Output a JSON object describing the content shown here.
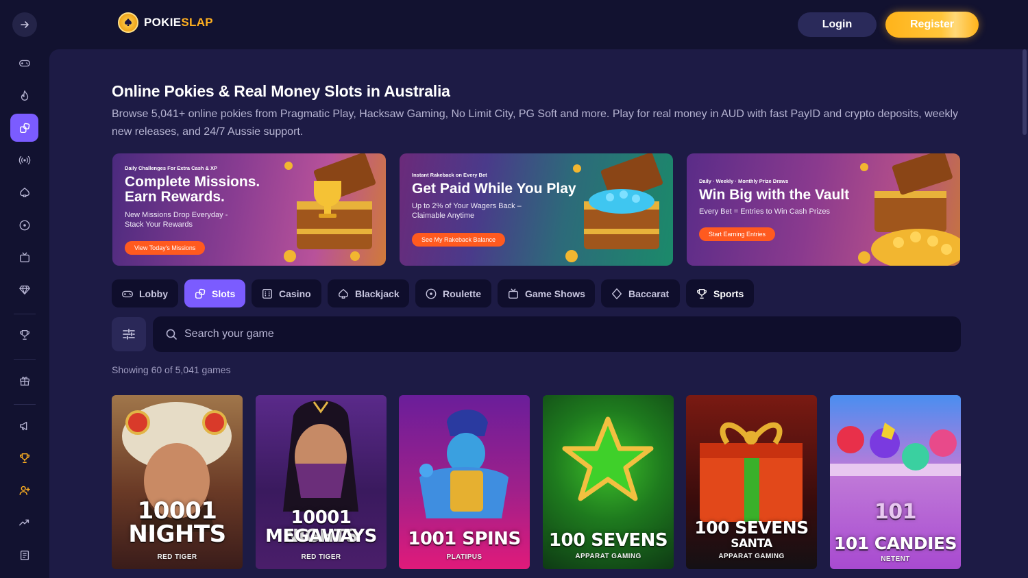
{
  "brand": {
    "name_main": "POKIE",
    "name_accent": "SLAP",
    "accent_color": "#ffb020",
    "primary_color": "#7b5cff"
  },
  "header": {
    "login_label": "Login",
    "register_label": "Register"
  },
  "sidebar": {
    "items": [
      {
        "name": "gamepad-icon",
        "active": false
      },
      {
        "name": "flame-icon",
        "active": false
      },
      {
        "name": "slots-icon",
        "active": true
      },
      {
        "name": "live-icon",
        "active": false
      },
      {
        "name": "blackjack-icon",
        "active": false
      },
      {
        "name": "roulette-icon",
        "active": false
      },
      {
        "name": "tv-icon",
        "active": false
      },
      {
        "name": "diamond-icon",
        "active": false
      },
      {
        "name": "trophy-icon",
        "active": false
      },
      {
        "name": "gift-icon",
        "active": false
      },
      {
        "name": "megaphone-icon",
        "active": false
      },
      {
        "name": "trophy-gold-icon",
        "active": false
      },
      {
        "name": "add-user-icon",
        "active": false
      },
      {
        "name": "trending-icon",
        "active": false
      },
      {
        "name": "news-icon",
        "active": false
      }
    ]
  },
  "page": {
    "title": "Online Pokies & Real Money Slots in Australia",
    "description": "Browse 5,041+ online pokies from Pragmatic Play, Hacksaw Gaming, No Limit City, PG Soft and more. Play for real money in AUD with fast PayID and crypto deposits, weekly new releases, and 24/7 Aussie support."
  },
  "banners": [
    {
      "kicker": "Daily Challenges For Extra Cash & XP",
      "title_line1": "Complete Missions.",
      "title_line2": "Earn Rewards.",
      "subtitle_line1": "New Missions Drop Everyday -",
      "subtitle_line2": "Stack Your Rewards",
      "button": "View Today's Missions"
    },
    {
      "kicker": "Instant Rakeback on Every Bet",
      "title_line1": "Get Paid While You Play",
      "subtitle_line1": "Up to 2% of Your Wagers Back –",
      "subtitle_line2": "Claimable Anytime",
      "button": "See My Rakeback Balance"
    },
    {
      "kicker": "Daily  ·  Weekly  ·  Monthly Prize Draws",
      "title_line1": "Win Big with the Vault",
      "subtitle_line1": "Every Bet = Entries to Win Cash Prizes",
      "button": "Start Earning Entries"
    }
  ],
  "tabs": [
    {
      "label": "Lobby",
      "icon": "gamepad-icon"
    },
    {
      "label": "Slots",
      "icon": "slots-icon"
    },
    {
      "label": "Casino",
      "icon": "casino-icon"
    },
    {
      "label": "Blackjack",
      "icon": "spade-icon"
    },
    {
      "label": "Roulette",
      "icon": "roulette-icon"
    },
    {
      "label": "Game Shows",
      "icon": "tv-icon"
    },
    {
      "label": "Baccarat",
      "icon": "diamond-icon"
    },
    {
      "label": "Sports",
      "icon": "trophy-icon"
    }
  ],
  "search": {
    "placeholder": "Search your game"
  },
  "results": {
    "showing_text": "Showing 60 of 5,041 games"
  },
  "games": [
    {
      "title_line1": "10001",
      "title_line2": "NIGHTS",
      "provider": "RED TIGER"
    },
    {
      "title_line1": "10001 NIGHTS",
      "title_line2": "MEGAWAYS",
      "provider": "RED TIGER"
    },
    {
      "title_line1": "1001 SPINS",
      "provider": "PLATIPUS"
    },
    {
      "title_line1": "100 SEVENS",
      "provider": "APPARAT GAMING"
    },
    {
      "title_line1": "100 SEVENS",
      "title_line2": "SANTA",
      "provider": "APPARAT GAMING"
    },
    {
      "title_line1": "101",
      "title_line2": "101 CANDIES",
      "provider": "NETENT"
    }
  ]
}
